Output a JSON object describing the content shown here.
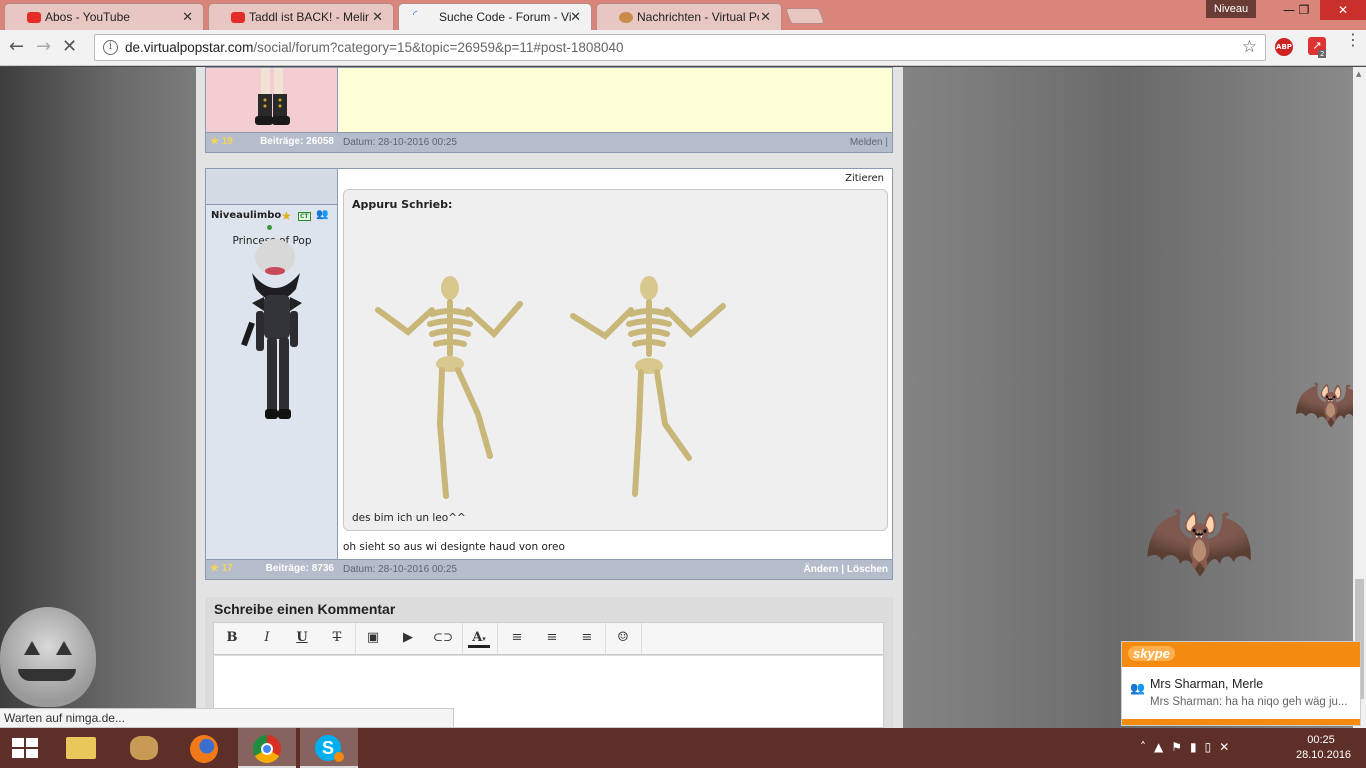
{
  "browser": {
    "tabs": [
      {
        "title": "Abos - YouTube",
        "favicon_color": "#e52d27",
        "active": false
      },
      {
        "title": "Taddl ist BACK! - Melina",
        "favicon_color": "#e52d27",
        "active": false
      },
      {
        "title": "Suche Code - Forum - Vi",
        "favicon_color": "#2b6cc4",
        "active": true
      },
      {
        "title": "Nachrichten - Virtual Pop",
        "favicon_color": "#c98a4a",
        "active": false
      }
    ],
    "profile_badge": "Niveau",
    "url_domain": "de.virtualpopstar.com",
    "url_path": "/social/forum?category=15&topic=26959&p=11#post-1808040",
    "ext_badge": "2"
  },
  "post1": {
    "level": "19",
    "posts": "Beiträge: 26058",
    "date": "Datum: 28-10-2016 00:25",
    "actions": "Melden |"
  },
  "post2": {
    "username": "Niveaulimbo",
    "badge": "CT",
    "title": "Princess of Pop",
    "quote_button": "Zitieren",
    "quote_author": "Appuru Schrieb:",
    "quote_text": "des bim ich un leo^^",
    "message": "oh sieht so aus wi designte haud von oreo",
    "level": "17",
    "posts": "Beiträge: 8736",
    "date": "Datum: 28-10-2016 00:25",
    "actions": "Ändern | Löschen"
  },
  "comment": {
    "title": "Schreibe einen Kommentar",
    "toolbar": [
      "B",
      "I",
      "U",
      "T",
      "image",
      "video",
      "link",
      "A",
      "align-left",
      "align-center",
      "align-right",
      "smiley"
    ]
  },
  "status_text": "Warten auf nimga.de...",
  "skype": {
    "logo": "skype",
    "name": "Mrs Sharman, Merle",
    "message": "Mrs Sharman: ha ha niqo geh wäg ju..."
  },
  "clock": {
    "time": "00:25",
    "date": "28.10.2016"
  }
}
